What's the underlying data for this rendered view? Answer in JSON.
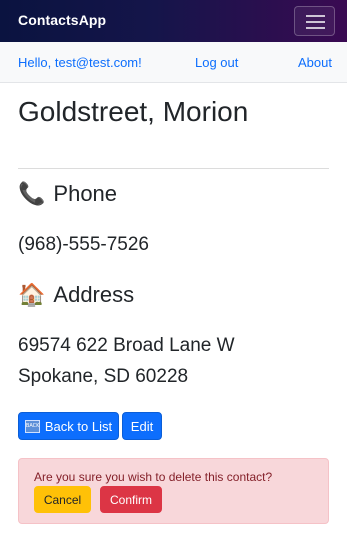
{
  "navbar": {
    "brand": "ContactsApp",
    "toggler_icon": "hamburger-menu-icon"
  },
  "subnav": {
    "greeting": "Hello, test@test.com!",
    "logout": "Log out",
    "about": "About"
  },
  "contact": {
    "name": "Goldstreet, Morion",
    "phone_heading": "Phone",
    "phone_icon": "📞",
    "phone": "(968)-555-7526",
    "address_heading": "Address",
    "address_icon": "🏠",
    "address_line1": "69574 622 Broad Lane W",
    "address_line2": "Spokane, SD 60228"
  },
  "actions": {
    "back_icon": "BACK",
    "back_label": "Back to List",
    "edit_label": "Edit"
  },
  "delete_alert": {
    "message": "Are you sure you wish to delete this contact?",
    "cancel_label": "Cancel",
    "confirm_label": "Confirm"
  },
  "colors": {
    "primary": "#0d6efd",
    "warning": "#ffc107",
    "danger": "#dc3545",
    "alert_bg": "#f8d7da",
    "navbar_start": "#0a1340",
    "navbar_end": "#3a0a52"
  }
}
